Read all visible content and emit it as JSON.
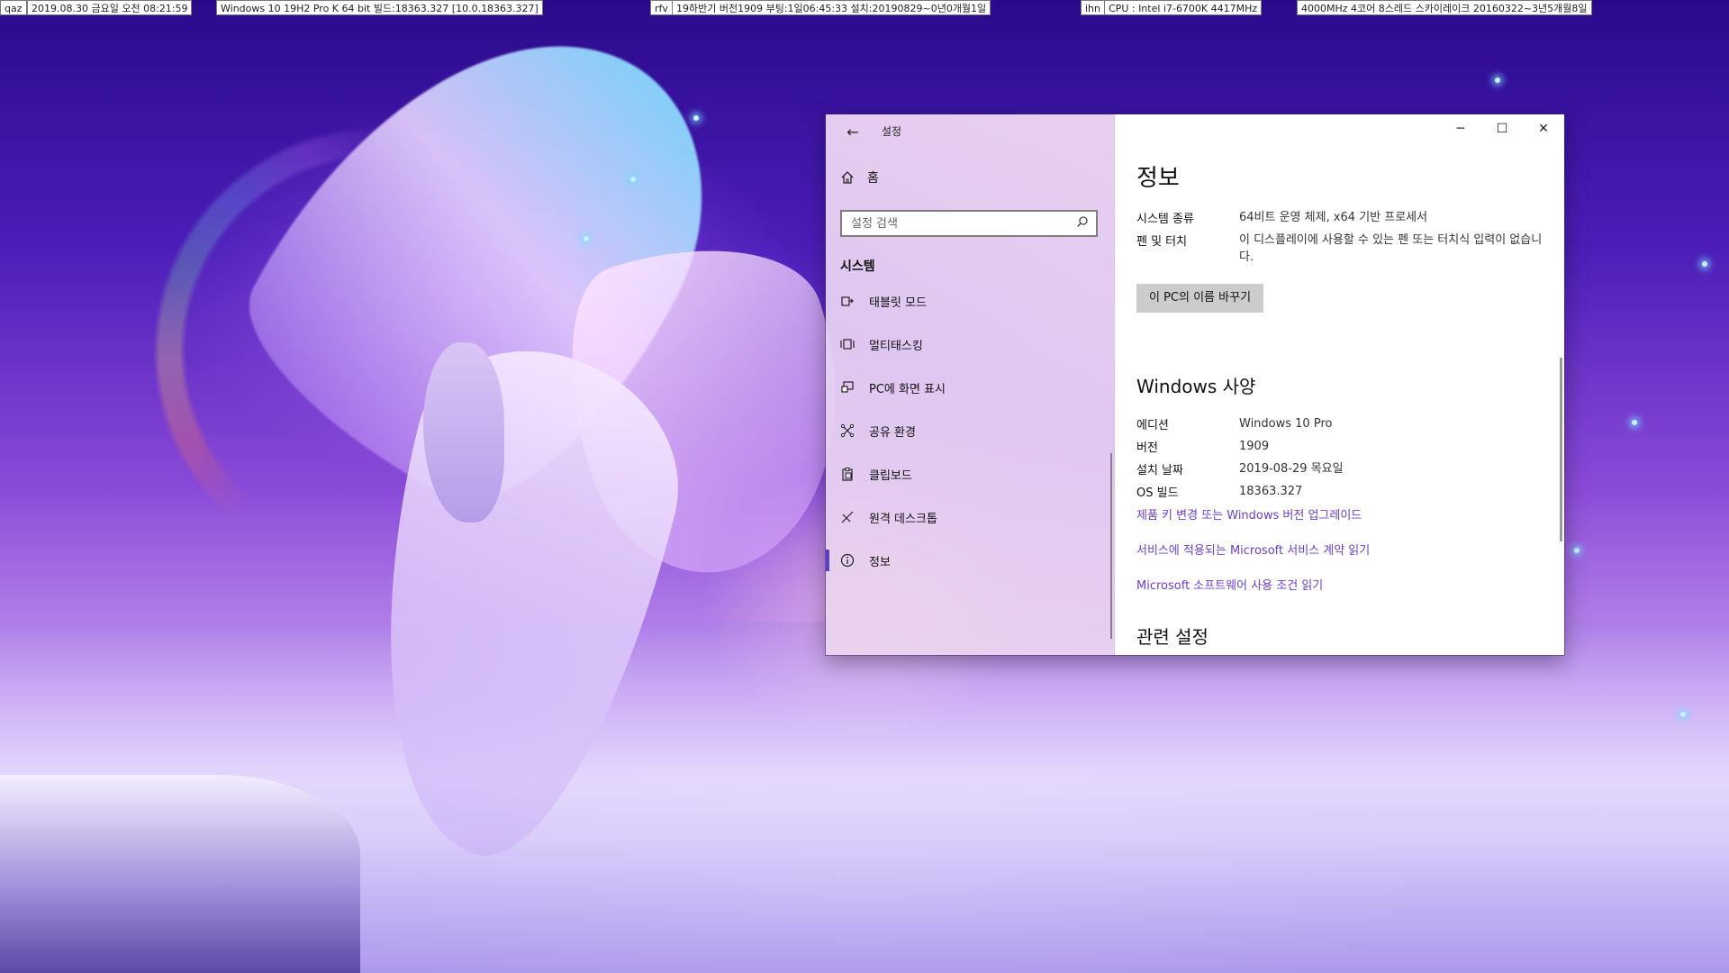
{
  "infobar": [
    {
      "label": "qaz",
      "text": "2019.08.30 금요일 오전 08:21:59"
    },
    {
      "label": "",
      "text": "Windows 10 19H2 Pro K 64 bit 빌드:18363.327 [10.0.18363.327]"
    },
    {
      "label": "rfv",
      "text": "19하반기 버전1909 부팅:1일06:45:33 설치:20190829~0년0개월1일"
    },
    {
      "label": "ihn",
      "text": "CPU : Intel i7-6700K 4417MHz"
    },
    {
      "label": "",
      "text": "4000MHz 4코어 8스레드 스카이레이크 20160322~3년5개월8일"
    }
  ],
  "window": {
    "title": "설정",
    "back_icon": "back-arrow-icon",
    "home_label": "홈",
    "search_placeholder": "설정 검색",
    "section": "시스템",
    "nav": [
      {
        "label": "태블릿 모드",
        "icon": "tablet-mode-icon"
      },
      {
        "label": "멀티태스킹",
        "icon": "multitasking-icon"
      },
      {
        "label": "PC에 화면 표시",
        "icon": "project-icon"
      },
      {
        "label": "공유 환경",
        "icon": "shared-experiences-icon"
      },
      {
        "label": "클립보드",
        "icon": "clipboard-icon"
      },
      {
        "label": "원격 데스크톱",
        "icon": "remote-desktop-icon"
      },
      {
        "label": "정보",
        "icon": "info-icon",
        "active": true
      }
    ],
    "controls": {
      "minimize": "─",
      "maximize": "☐",
      "close": "✕"
    }
  },
  "content": {
    "title": "정보",
    "system_type_key": "시스템 종류",
    "system_type_val": "64비트 운영 체제, x64 기반 프로세서",
    "pen_key": "펜 및 터치",
    "pen_val": "이 디스플레이에 사용할 수 있는 펜 또는 터치식 입력이 없습니다.",
    "rename_button": "이 PC의 이름 바꾸기",
    "windows_spec": "Windows 사양",
    "edition_key": "에디션",
    "edition_val": "Windows 10 Pro",
    "version_key": "버전",
    "version_val": "1909",
    "install_key": "설치 날짜",
    "install_val": "2019-08-29 목요일",
    "build_key": "OS 빌드",
    "build_val": "18363.327",
    "link_upgrade": "제품 키 변경 또는 Windows 버전 업그레이드",
    "link_msa": "서비스에 적용되는 Microsoft 서비스 계약 읽기",
    "link_license": "Microsoft 소프트웨어 사용 조건 읽기",
    "related": "관련 설정"
  },
  "colors": {
    "accent": "#5b3fcf",
    "link": "#6a3fc3"
  }
}
